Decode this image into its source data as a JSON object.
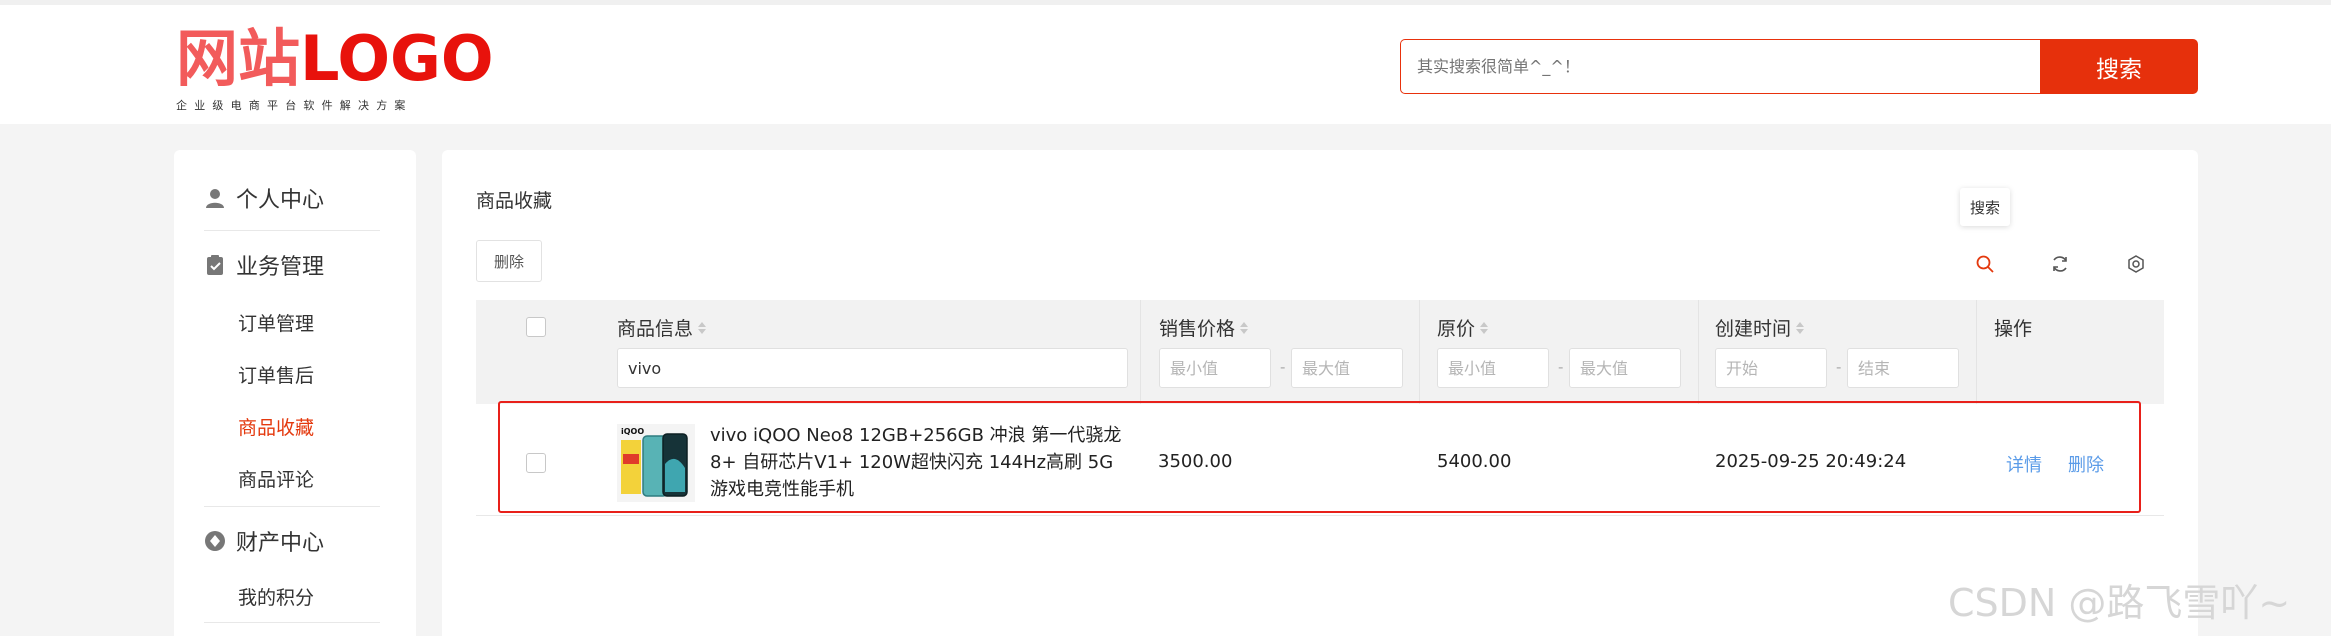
{
  "header": {
    "logo_cn": "网站",
    "logo_en": "LOGO",
    "logo_tagline": "企业级电商平台软件解决方案",
    "search_placeholder": "其实搜索很简单^_^！",
    "search_button": "搜索"
  },
  "sidebar": {
    "groups": [
      {
        "label": "个人中心",
        "icon": "user-icon"
      },
      {
        "label": "业务管理",
        "icon": "clipboard-check-icon",
        "items": [
          "订单管理",
          "订单售后",
          "商品收藏",
          "商品评论"
        ]
      },
      {
        "label": "财产中心",
        "icon": "diamond-icon",
        "items": [
          "我的积分"
        ]
      }
    ],
    "active_item": "商品收藏"
  },
  "main": {
    "title": "商品收藏",
    "delete_button": "删除",
    "tooltip": "搜索",
    "tools": [
      "search-icon",
      "refresh-icon",
      "settings-icon"
    ]
  },
  "table": {
    "columns": [
      "商品信息",
      "销售价格",
      "原价",
      "创建时间",
      "操作"
    ],
    "filters": {
      "name_value": "vivo",
      "min_placeholder": "最小值",
      "max_placeholder": "最大值",
      "start_placeholder": "开始",
      "end_placeholder": "结束",
      "range_sep": "-"
    },
    "rows": [
      {
        "name": "vivo iQOO Neo8 12GB+256GB 冲浪 第一代骁龙8+ 自研芯片V1+ 120W超快闪充 144Hz高刷 5G游戏电竞性能手机",
        "price": "3500.00",
        "original_price": "5400.00",
        "created": "2025-09-25 20:49:24",
        "actions": [
          "详情",
          "删除"
        ]
      }
    ]
  },
  "watermark": "CSDN @路飞雪吖~",
  "colors": {
    "accent": "#e6300c",
    "link": "#5a9be8",
    "highlight": "#e8201a"
  }
}
